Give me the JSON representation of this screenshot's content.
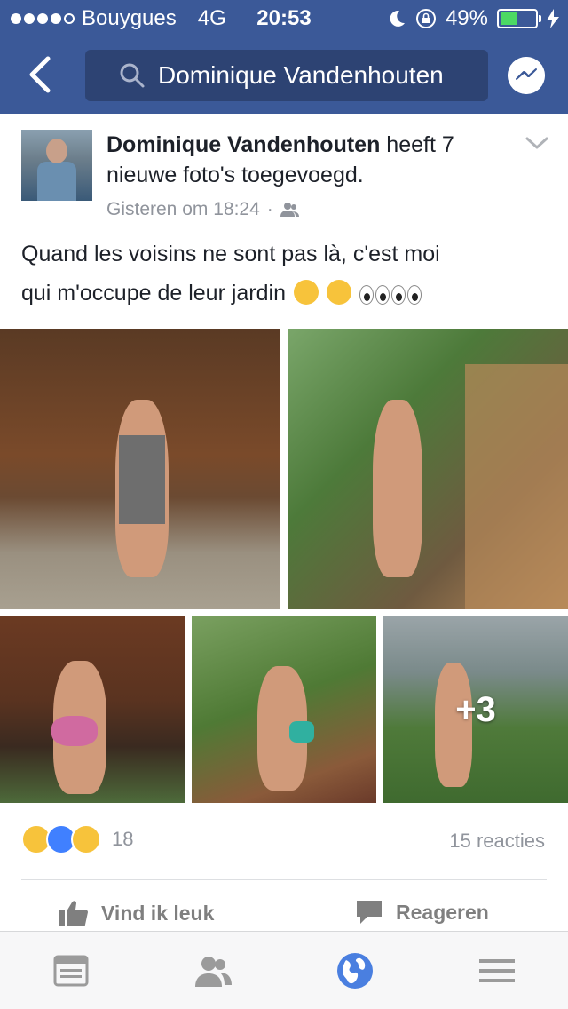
{
  "status": {
    "carrier": "Bouygues",
    "network": "4G",
    "time": "20:53",
    "battery_percent": "49%",
    "battery_level": 0.49
  },
  "nav": {
    "search_text": "Dominique Vandenhouten"
  },
  "post": {
    "author": "Dominique Vandenhouten",
    "action": "heeft 7 nieuwe foto's toegevoegd.",
    "timestamp": "Gisteren om 18:24",
    "privacy_icon": "friends-icon",
    "message_line1": "Quand les voisins ne sont pas là,  c'est moi",
    "message_line2": "qui m'occupe de leur jardin",
    "photo_count": 7,
    "more_photos": "+3"
  },
  "engagement": {
    "reaction_count": "18",
    "comments": "15 reacties",
    "reactions": [
      "haha",
      "like",
      "wow"
    ]
  },
  "actions": {
    "like_label": "Vind ik leuk",
    "comment_label": "Reageren"
  },
  "colors": {
    "brand": "#3b5998",
    "search_bg": "#2d4373",
    "battery": "#4cd964",
    "muted": "#90949c"
  }
}
